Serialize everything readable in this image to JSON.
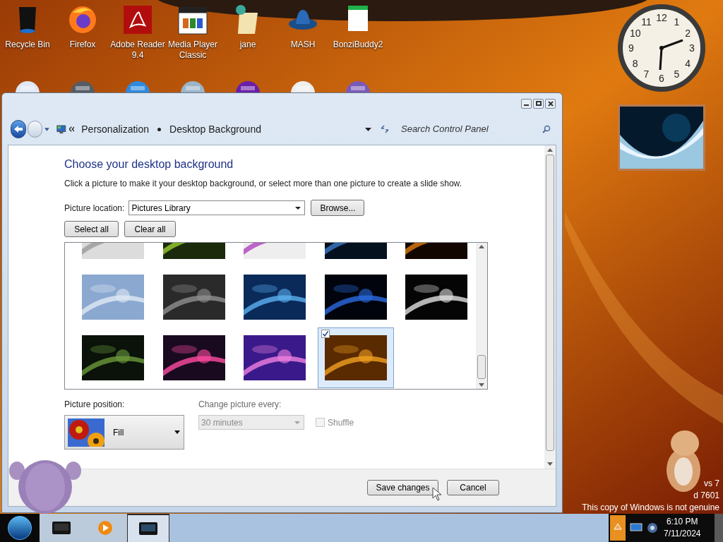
{
  "desktop_icons": [
    {
      "label": "Recycle Bin"
    },
    {
      "label": "Firefox"
    },
    {
      "label": "Adobe Reader 9.4"
    },
    {
      "label": "Media Player Classic"
    },
    {
      "label": "jane"
    },
    {
      "label": "MASH"
    },
    {
      "label": "BonziBuddy2"
    }
  ],
  "clock_gadget": {
    "numerals": [
      "12",
      "11",
      "1",
      "10",
      "2",
      "9",
      "3",
      "8",
      "4",
      "7",
      "5",
      "6"
    ]
  },
  "window": {
    "breadcrumb": [
      "Personalization",
      "Desktop Background"
    ],
    "search": {
      "placeholder": "Search Control Panel"
    },
    "heading": "Choose your desktop background",
    "description": "Click a picture to make it your desktop background, or select more than one picture to create a slide show.",
    "picture_location": {
      "label": "Picture location:",
      "value": "Pictures Library"
    },
    "browse_button": "Browse...",
    "select_all_button": "Select all",
    "clear_all_button": "Clear all",
    "thumbnails": [
      {
        "selected": false
      },
      {
        "selected": false
      },
      {
        "selected": false
      },
      {
        "selected": false
      },
      {
        "selected": false
      },
      {
        "selected": false
      },
      {
        "selected": false
      },
      {
        "selected": false
      },
      {
        "selected": false
      },
      {
        "selected": false
      },
      {
        "selected": false
      },
      {
        "selected": false
      },
      {
        "selected": false
      },
      {
        "selected": true
      }
    ],
    "picture_position": {
      "label": "Picture position:",
      "value": "Fill"
    },
    "change_picture": {
      "label": "Change picture every:",
      "value": "30 minutes",
      "disabled": true
    },
    "shuffle": {
      "label": "Shuffle",
      "checked": false,
      "disabled": true
    },
    "buttons": [
      "Save changes",
      "Cancel"
    ]
  },
  "desktop_notice": [
    "vs 7",
    "d 7601",
    "This copy of Windows is not genuine"
  ],
  "taskbar": {
    "buttons": [
      {
        "selected": false
      },
      {
        "selected": false
      },
      {
        "selected": true
      }
    ],
    "time": "6:10 PM",
    "date": "7/11/2024"
  }
}
